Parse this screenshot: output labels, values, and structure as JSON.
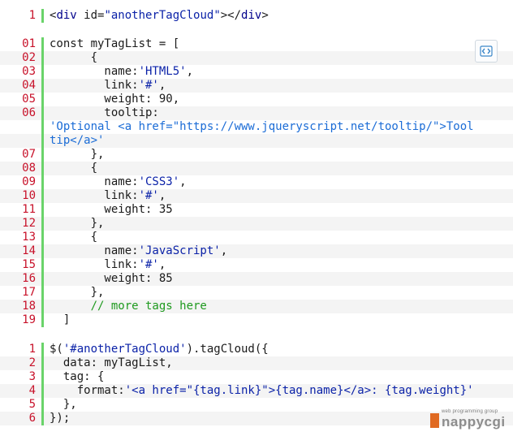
{
  "block1": {
    "lines": [
      {
        "n": "1",
        "tokens": [
          {
            "t": "<",
            "c": "sym"
          },
          {
            "t": "div",
            "c": "tagn"
          },
          {
            "t": " id=",
            "c": "sym"
          },
          {
            "t": "\"anotherTagCloud\"",
            "c": "str"
          },
          {
            "t": "></",
            "c": "sym"
          },
          {
            "t": "div",
            "c": "tagn"
          },
          {
            "t": ">",
            "c": "sym"
          }
        ]
      }
    ]
  },
  "block2": {
    "lines": [
      {
        "n": "01",
        "tokens": [
          {
            "t": "const myTagList = [",
            "c": "kw"
          }
        ]
      },
      {
        "n": "02",
        "tokens": [
          {
            "t": "      {",
            "c": "sym"
          }
        ]
      },
      {
        "n": "03",
        "tokens": [
          {
            "t": "        name:",
            "c": "sym"
          },
          {
            "t": "'HTML5'",
            "c": "str"
          },
          {
            "t": ",",
            "c": "sym"
          }
        ]
      },
      {
        "n": "04",
        "tokens": [
          {
            "t": "        link:",
            "c": "sym"
          },
          {
            "t": "'#'",
            "c": "str"
          },
          {
            "t": ",",
            "c": "sym"
          }
        ]
      },
      {
        "n": "05",
        "tokens": [
          {
            "t": "        weight: 90,",
            "c": "sym"
          }
        ]
      },
      {
        "n": "06",
        "tokens": [
          {
            "t": "        tooltip:",
            "c": "sym"
          }
        ]
      },
      {
        "n": "",
        "tokens": [
          {
            "t": "'Optional <a href=\"https://www.jqueryscript.net/tooltip/\">Tool",
            "c": "str2"
          }
        ]
      },
      {
        "n": "",
        "tokens": [
          {
            "t": "tip</a>'",
            "c": "str2"
          }
        ]
      },
      {
        "n": "07",
        "tokens": [
          {
            "t": "      },",
            "c": "sym"
          }
        ]
      },
      {
        "n": "08",
        "tokens": [
          {
            "t": "      {",
            "c": "sym"
          }
        ]
      },
      {
        "n": "09",
        "tokens": [
          {
            "t": "        name:",
            "c": "sym"
          },
          {
            "t": "'CSS3'",
            "c": "str"
          },
          {
            "t": ",",
            "c": "sym"
          }
        ]
      },
      {
        "n": "10",
        "tokens": [
          {
            "t": "        link:",
            "c": "sym"
          },
          {
            "t": "'#'",
            "c": "str"
          },
          {
            "t": ",",
            "c": "sym"
          }
        ]
      },
      {
        "n": "11",
        "tokens": [
          {
            "t": "        weight: 35",
            "c": "sym"
          }
        ]
      },
      {
        "n": "12",
        "tokens": [
          {
            "t": "      },",
            "c": "sym"
          }
        ]
      },
      {
        "n": "13",
        "tokens": [
          {
            "t": "      {",
            "c": "sym"
          }
        ]
      },
      {
        "n": "14",
        "tokens": [
          {
            "t": "        name:",
            "c": "sym"
          },
          {
            "t": "'JavaScript'",
            "c": "str"
          },
          {
            "t": ",",
            "c": "sym"
          }
        ]
      },
      {
        "n": "15",
        "tokens": [
          {
            "t": "        link:",
            "c": "sym"
          },
          {
            "t": "'#'",
            "c": "str"
          },
          {
            "t": ",",
            "c": "sym"
          }
        ]
      },
      {
        "n": "16",
        "tokens": [
          {
            "t": "        weight: 85",
            "c": "sym"
          }
        ]
      },
      {
        "n": "17",
        "tokens": [
          {
            "t": "      },",
            "c": "sym"
          }
        ]
      },
      {
        "n": "18",
        "tokens": [
          {
            "t": "      // more tags here",
            "c": "cmt"
          }
        ]
      },
      {
        "n": "19",
        "tokens": [
          {
            "t": "  ]",
            "c": "sym"
          }
        ]
      }
    ]
  },
  "block3": {
    "lines": [
      {
        "n": "1",
        "tokens": [
          {
            "t": "$(",
            "c": "sym"
          },
          {
            "t": "'#anotherTagCloud'",
            "c": "str"
          },
          {
            "t": ").tagCloud({",
            "c": "sym"
          }
        ]
      },
      {
        "n": "2",
        "tokens": [
          {
            "t": "  data: myTagList,",
            "c": "sym"
          }
        ]
      },
      {
        "n": "3",
        "tokens": [
          {
            "t": "  tag: {",
            "c": "sym"
          }
        ]
      },
      {
        "n": "4",
        "tokens": [
          {
            "t": "    format:",
            "c": "sym"
          },
          {
            "t": "'<a href=\"{tag.link}\">{tag.name}</a>: {tag.weight}'",
            "c": "str"
          }
        ]
      },
      {
        "n": "5",
        "tokens": [
          {
            "t": "  },",
            "c": "sym"
          }
        ]
      },
      {
        "n": "6",
        "tokens": [
          {
            "t": "});",
            "c": "sym"
          }
        ]
      }
    ]
  },
  "toolbar": {
    "view_source_icon": "view-source-icon"
  },
  "watermark": {
    "small": "web programming group",
    "main": "nappycgi"
  }
}
